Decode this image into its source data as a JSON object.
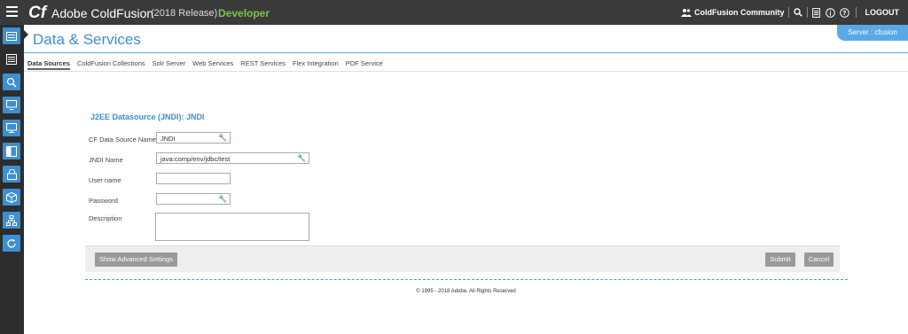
{
  "topbar": {
    "logo": "Cf",
    "title": "Adobe ColdFusion",
    "release": "(2018 Release)",
    "edition": "Developer",
    "community": "ColdFusion Community",
    "logout": "LOGOUT"
  },
  "page": {
    "title": "Data & Services",
    "server_label": "Server : cfusion"
  },
  "tabs": [
    "Data Sources",
    "ColdFusion Collections",
    "Solr Server",
    "Web Services",
    "REST Services",
    "Flex Integration",
    "PDF Service"
  ],
  "form": {
    "title": "J2EE Datasource (JNDI): JNDI",
    "ds_name_label": "CF Data Source Name",
    "ds_name_value": "JNDI",
    "jndi_label": "JNDI Name",
    "jndi_value": "java:comp/env/jdbc/test",
    "username_label": "User name",
    "username_value": "",
    "password_label": "Password",
    "password_value": "",
    "description_label": "Description"
  },
  "actions": {
    "advanced": "Show Advanced Settings",
    "submit": "Submit",
    "cancel": "Cancel"
  },
  "footer": "© 1995 - 2018 Adobe. All Rights Reserved",
  "colors": {
    "accent": "#3d8fd1",
    "edition": "#7fc14a",
    "topbar": "#3a3a3a"
  }
}
